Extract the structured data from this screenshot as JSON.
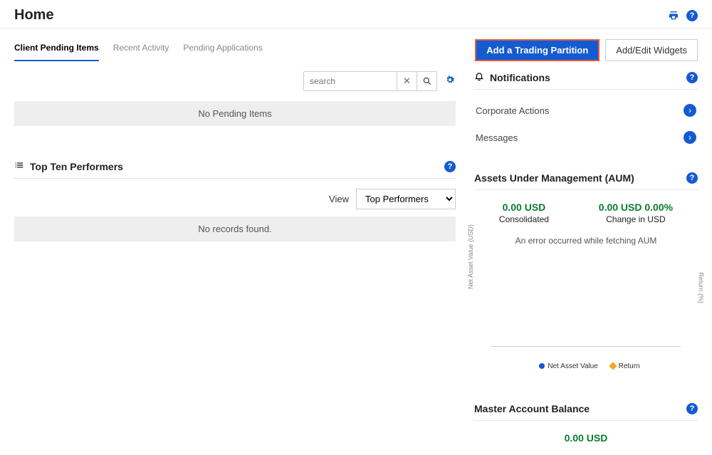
{
  "header": {
    "title": "Home"
  },
  "tabs": [
    {
      "label": "Client Pending Items",
      "active": true
    },
    {
      "label": "Recent Activity",
      "active": false
    },
    {
      "label": "Pending Applications",
      "active": false
    }
  ],
  "buttons": {
    "add_partition": "Add a Trading Partition",
    "add_edit_widgets": "Add/Edit Widgets"
  },
  "search": {
    "placeholder": "search",
    "value": ""
  },
  "pending": {
    "empty_text": "No Pending Items"
  },
  "top_ten": {
    "title": "Top Ten Performers",
    "view_label": "View",
    "view_value": "Top Performers",
    "empty_text": "No records found."
  },
  "notifications": {
    "title": "Notifications",
    "items": [
      "Corporate Actions",
      "Messages"
    ]
  },
  "aum": {
    "title": "Assets Under Management (AUM)",
    "value": "0.00 USD",
    "value_label": "Consolidated",
    "change": "0.00 USD 0.00%",
    "change_label": "Change in USD",
    "error": "An error occurred while fetching AUM",
    "y_label": "Net Asset Value (USD)",
    "y2_label": "Return (%)",
    "legend1": "Net Asset Value",
    "legend2": "Return"
  },
  "mab": {
    "title": "Master Account Balance",
    "value": "0.00 USD"
  },
  "chart_data": {
    "type": "line",
    "series": [
      {
        "name": "Net Asset Value",
        "values": []
      },
      {
        "name": "Return",
        "values": []
      }
    ],
    "xlabel": "",
    "ylabel": "Net Asset Value (USD)",
    "y2label": "Return (%)",
    "note": "An error occurred while fetching AUM"
  }
}
